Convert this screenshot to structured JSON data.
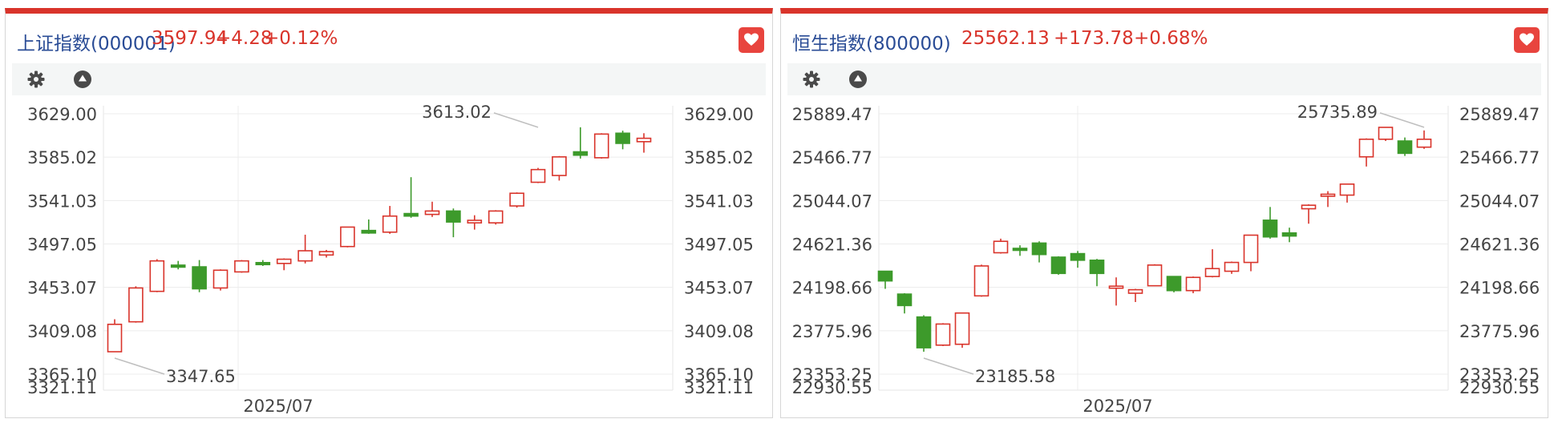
{
  "panels": [
    {
      "title": "上证指数(000001)",
      "price": "3597.94",
      "change": "+4.28",
      "change_pct": "+0.12%"
    },
    {
      "title": "恒生指数(800000)",
      "price": "25562.13",
      "change": "+173.78",
      "change_pct": "+0.68%"
    }
  ],
  "icons": {
    "favorite": "heart-icon",
    "settings": "gear-icon",
    "collapse": "triangle-up-icon"
  },
  "colors": {
    "up": "#d9342b",
    "down": "#3d9a2b",
    "title": "#2a4c96",
    "accent_bar": "#d9342b"
  },
  "chart_data": [
    {
      "type": "candlestick",
      "ylim": [
        3321.11,
        3629.0
      ],
      "yticks": [
        "3629.00",
        "3585.02",
        "3541.03",
        "3497.05",
        "3453.07",
        "3409.08",
        "3365.10",
        "3321.11"
      ],
      "xticks": [
        {
          "label": "2025/07",
          "index": 5
        }
      ],
      "annotations": [
        {
          "label": "3613.02",
          "value": 3613.02,
          "index": 20,
          "kind": "high"
        },
        {
          "label": "3347.65",
          "value": 3347.65,
          "index": 0,
          "kind": "low"
        }
      ],
      "candles": [
        {
          "o": 3347.6,
          "c": 3380.0,
          "h": 3386.0,
          "l": 3347.6,
          "dir": "up"
        },
        {
          "o": 3383.0,
          "c": 3423.0,
          "h": 3425.0,
          "l": 3382.0,
          "dir": "up"
        },
        {
          "o": 3419.0,
          "c": 3455.0,
          "h": 3457.0,
          "l": 3418.0,
          "dir": "up"
        },
        {
          "o": 3450.0,
          "c": 3448.0,
          "h": 3455.0,
          "l": 3445.0,
          "dir": "down"
        },
        {
          "o": 3448.0,
          "c": 3422.0,
          "h": 3456.0,
          "l": 3418.0,
          "dir": "down"
        },
        {
          "o": 3423.0,
          "c": 3444.0,
          "h": 3445.0,
          "l": 3420.0,
          "dir": "up"
        },
        {
          "o": 3442.0,
          "c": 3455.0,
          "h": 3456.0,
          "l": 3441.0,
          "dir": "up"
        },
        {
          "o": 3453.0,
          "c": 3451.0,
          "h": 3456.0,
          "l": 3449.0,
          "dir": "down"
        },
        {
          "o": 3452.0,
          "c": 3457.0,
          "h": 3458.0,
          "l": 3444.0,
          "dir": "up"
        },
        {
          "o": 3455.0,
          "c": 3467.0,
          "h": 3486.0,
          "l": 3452.0,
          "dir": "up"
        },
        {
          "o": 3462.0,
          "c": 3466.0,
          "h": 3468.0,
          "l": 3459.0,
          "dir": "up"
        },
        {
          "o": 3472.0,
          "c": 3495.0,
          "h": 3495.0,
          "l": 3471.0,
          "dir": "up"
        },
        {
          "o": 3491.0,
          "c": 3488.0,
          "h": 3504.0,
          "l": 3487.0,
          "dir": "down"
        },
        {
          "o": 3489.0,
          "c": 3508.0,
          "h": 3520.0,
          "l": 3487.0,
          "dir": "up"
        },
        {
          "o": 3511.0,
          "c": 3508.0,
          "h": 3554.0,
          "l": 3506.0,
          "dir": "down"
        },
        {
          "o": 3510.0,
          "c": 3514.0,
          "h": 3525.0,
          "l": 3507.0,
          "dir": "up"
        },
        {
          "o": 3514.0,
          "c": 3501.0,
          "h": 3517.0,
          "l": 3483.0,
          "dir": "down"
        },
        {
          "o": 3500.0,
          "c": 3503.0,
          "h": 3509.0,
          "l": 3492.0,
          "dir": "up"
        },
        {
          "o": 3500.0,
          "c": 3514.0,
          "h": 3515.0,
          "l": 3498.0,
          "dir": "up"
        },
        {
          "o": 3520.0,
          "c": 3535.0,
          "h": 3536.0,
          "l": 3518.0,
          "dir": "up"
        },
        {
          "o": 3548.0,
          "c": 3563.0,
          "h": 3565.0,
          "l": 3547.0,
          "dir": "up"
        },
        {
          "o": 3556.0,
          "c": 3578.0,
          "h": 3579.0,
          "l": 3550.0,
          "dir": "up"
        },
        {
          "o": 3584.0,
          "c": 3580.0,
          "h": 3613.0,
          "l": 3576.0,
          "dir": "down"
        },
        {
          "o": 3577.0,
          "c": 3605.0,
          "h": 3606.0,
          "l": 3576.0,
          "dir": "up"
        },
        {
          "o": 3606.0,
          "c": 3594.0,
          "h": 3609.0,
          "l": 3587.0,
          "dir": "down"
        },
        {
          "o": 3596.0,
          "c": 3600.0,
          "h": 3606.0,
          "l": 3583.0,
          "dir": "up"
        }
      ]
    },
    {
      "type": "candlestick",
      "ylim": [
        22930.55,
        25889.47
      ],
      "yticks": [
        "25889.47",
        "25466.77",
        "25044.07",
        "24621.36",
        "24198.66",
        "23775.96",
        "23353.25",
        "22930.55"
      ],
      "xticks": [
        {
          "label": "2025/07",
          "index": 10
        }
      ],
      "annotations": [
        {
          "label": "25735.89",
          "value": 25735.89,
          "index": 28,
          "kind": "high"
        },
        {
          "label": "23185.58",
          "value": 23185.58,
          "index": 2,
          "kind": "low"
        }
      ],
      "candles": [
        {
          "o": 24100,
          "c": 23990,
          "h": 24105,
          "l": 23900,
          "dir": "down"
        },
        {
          "o": 23840,
          "c": 23710,
          "h": 23850,
          "l": 23620,
          "dir": "down"
        },
        {
          "o": 23580,
          "c": 23230,
          "h": 23600,
          "l": 23185,
          "dir": "down"
        },
        {
          "o": 23260,
          "c": 23500,
          "h": 23510,
          "l": 23250,
          "dir": "up"
        },
        {
          "o": 23270,
          "c": 23625,
          "h": 23630,
          "l": 23230,
          "dir": "up"
        },
        {
          "o": 23820,
          "c": 24160,
          "h": 24175,
          "l": 23810,
          "dir": "up"
        },
        {
          "o": 24310,
          "c": 24440,
          "h": 24470,
          "l": 24300,
          "dir": "up"
        },
        {
          "o": 24360,
          "c": 24340,
          "h": 24395,
          "l": 24275,
          "dir": "down"
        },
        {
          "o": 24420,
          "c": 24290,
          "h": 24440,
          "l": 24200,
          "dir": "down"
        },
        {
          "o": 24260,
          "c": 24075,
          "h": 24270,
          "l": 24060,
          "dir": "down"
        },
        {
          "o": 24300,
          "c": 24225,
          "h": 24330,
          "l": 24140,
          "dir": "down"
        },
        {
          "o": 24225,
          "c": 24075,
          "h": 24240,
          "l": 23930,
          "dir": "down"
        },
        {
          "o": 23930,
          "c": 23920,
          "h": 24030,
          "l": 23710,
          "dir": "up"
        },
        {
          "o": 23850,
          "c": 23890,
          "h": 23900,
          "l": 23750,
          "dir": "up"
        },
        {
          "o": 23935,
          "c": 24170,
          "h": 24180,
          "l": 23930,
          "dir": "up"
        },
        {
          "o": 24040,
          "c": 23880,
          "h": 24045,
          "l": 23860,
          "dir": "down"
        },
        {
          "o": 23880,
          "c": 24030,
          "h": 24040,
          "l": 23850,
          "dir": "up"
        },
        {
          "o": 24040,
          "c": 24130,
          "h": 24350,
          "l": 24030,
          "dir": "up"
        },
        {
          "o": 24100,
          "c": 24200,
          "h": 24210,
          "l": 24070,
          "dir": "up"
        },
        {
          "o": 24200,
          "c": 24510,
          "h": 24515,
          "l": 24100,
          "dir": "up"
        },
        {
          "o": 24680,
          "c": 24490,
          "h": 24830,
          "l": 24470,
          "dir": "down"
        },
        {
          "o": 24535,
          "c": 24500,
          "h": 24595,
          "l": 24430,
          "dir": "down"
        },
        {
          "o": 24810,
          "c": 24850,
          "h": 24860,
          "l": 24640,
          "dir": "up"
        },
        {
          "o": 24960,
          "c": 24975,
          "h": 25010,
          "l": 24830,
          "dir": "up"
        },
        {
          "o": 24965,
          "c": 25090,
          "h": 25095,
          "l": 24880,
          "dir": "up"
        },
        {
          "o": 25400,
          "c": 25600,
          "h": 25610,
          "l": 25290,
          "dir": "up"
        },
        {
          "o": 25600,
          "c": 25735,
          "h": 25736,
          "l": 25580,
          "dir": "up"
        },
        {
          "o": 25580,
          "c": 25440,
          "h": 25620,
          "l": 25410,
          "dir": "down"
        },
        {
          "o": 25510,
          "c": 25600,
          "h": 25700,
          "l": 25490,
          "dir": "up"
        }
      ]
    }
  ]
}
